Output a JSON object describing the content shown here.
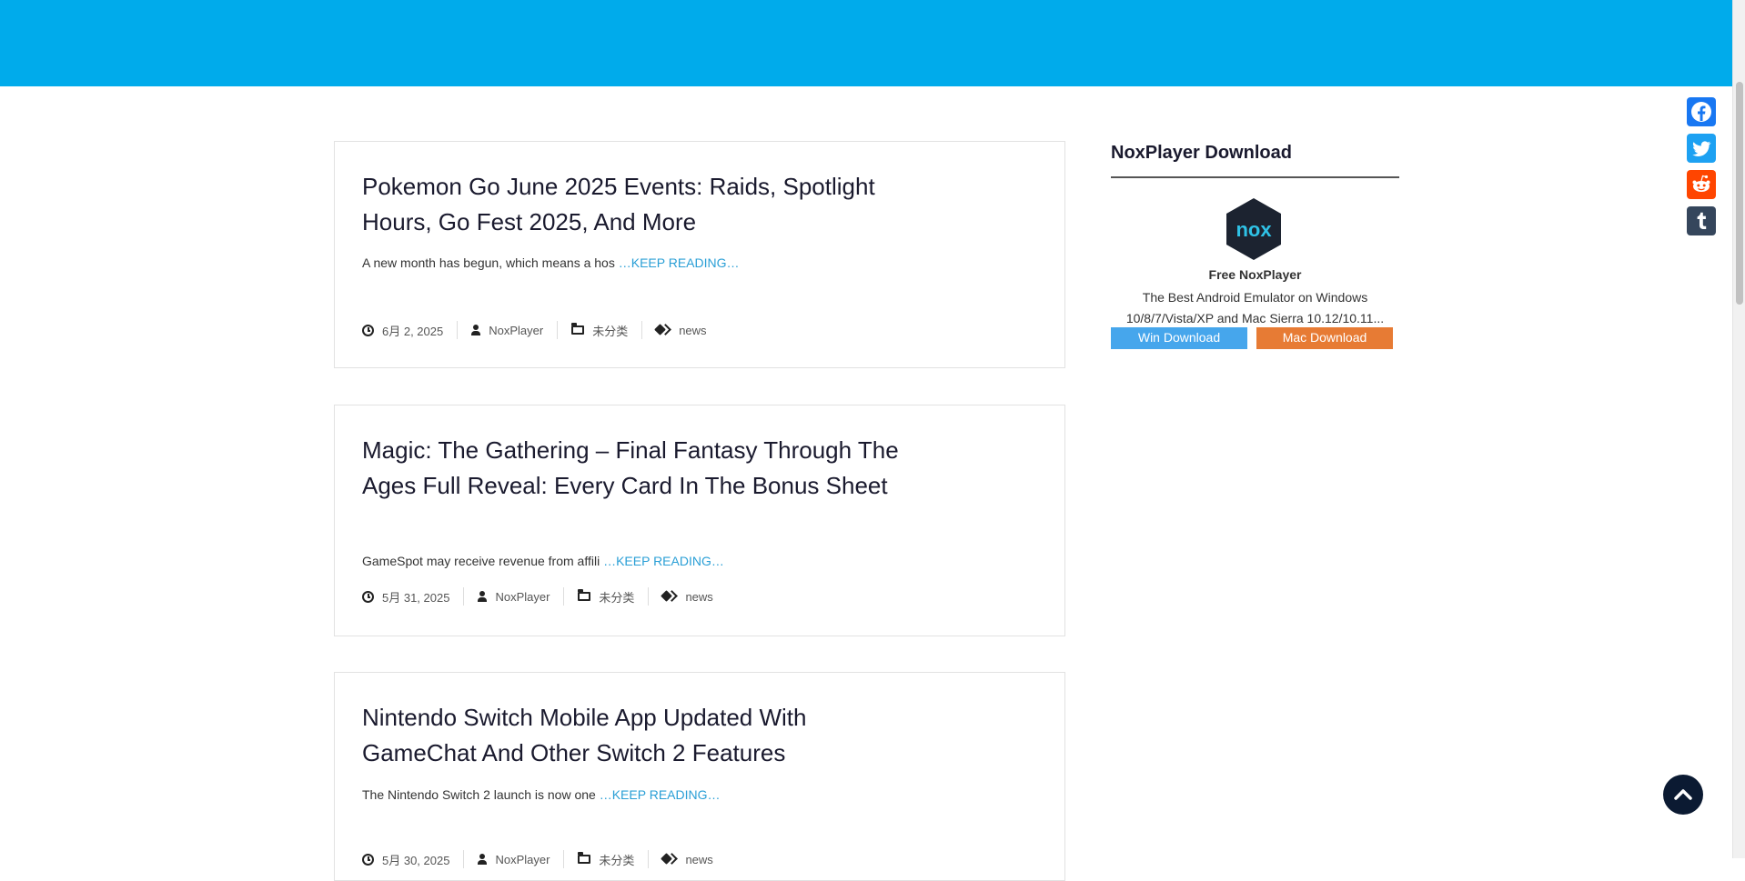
{
  "header": {
    "color": "#00abeb"
  },
  "posts": [
    {
      "title": "Pokemon Go June 2025 Events: Raids, Spotlight Hours, Go Fest 2025, And More",
      "excerpt": "A new month has begun, which means a hos ",
      "more": "…KEEP READING…",
      "date": "6月 2, 2025",
      "author": "NoxPlayer",
      "category": "未分类",
      "tag": "news"
    },
    {
      "title": "Magic: The Gathering – Final Fantasy Through The Ages Full Reveal: Every Card In The Bonus Sheet",
      "excerpt": "GameSpot may receive revenue from affili ",
      "more": "…KEEP READING…",
      "date": "5月 31, 2025",
      "author": "NoxPlayer",
      "category": "未分类",
      "tag": "news"
    },
    {
      "title": "Nintendo Switch Mobile App Updated With GameChat And Other Switch 2 Features",
      "excerpt": "The Nintendo Switch 2 launch is now one ",
      "more": "…KEEP READING…",
      "date": "5月 30, 2025",
      "author": "NoxPlayer",
      "category": "未分类",
      "tag": "news"
    }
  ],
  "sidebar": {
    "widget_title": "NoxPlayer Download",
    "logo_text": "nox",
    "product_name": "Free NoxPlayer",
    "description": "The Best Android Emulator on Windows 10/8/7/Vista/XP and Mac Sierra 10.12/10.11...",
    "win_label": "Win Download",
    "mac_label": "Mac Download"
  },
  "share": {
    "items": [
      {
        "icon": "facebook-icon",
        "color": "#1877f2"
      },
      {
        "icon": "twitter-icon",
        "color": "#1da1f2"
      },
      {
        "icon": "reddit-icon",
        "color": "#ff4500"
      },
      {
        "icon": "tumblr-icon",
        "color": "#35465c"
      }
    ]
  },
  "back_to_top": {
    "icon": "chevron-up-icon"
  }
}
